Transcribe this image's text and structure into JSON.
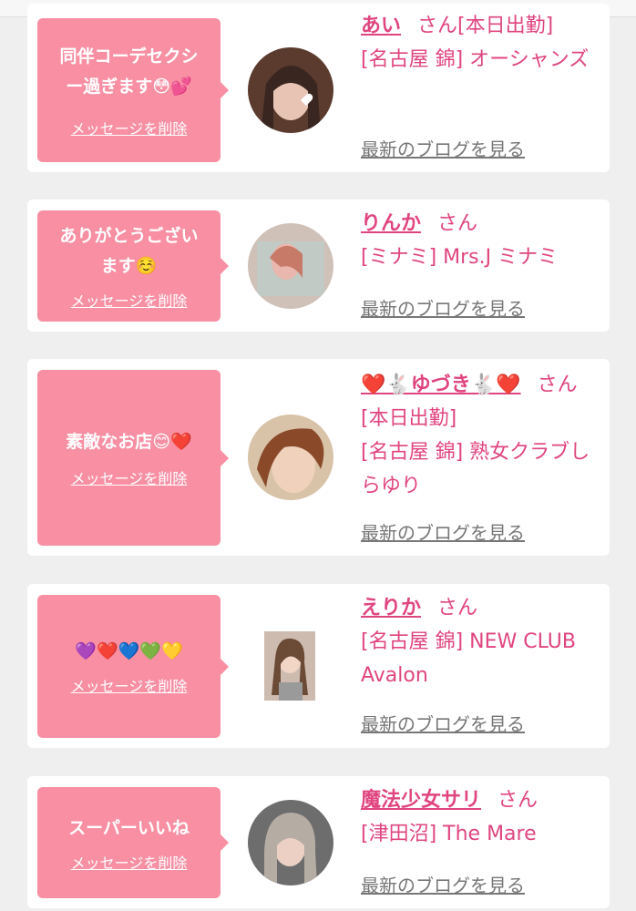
{
  "delete_label": "メッセージを削除",
  "blog_label": "最新のブログを見る",
  "honorific": "さん",
  "cards": [
    {
      "message_line1": "同伴コーデセクシ",
      "message_line2": "ー過ぎます😳💕",
      "name": "あい",
      "status": "[本日出勤]",
      "shop": "[名古屋 錦] オーシャンズ",
      "avatar_icon": "portrait-photo"
    },
    {
      "message_line1": "ありがとうござい",
      "message_line2": "ます☺️",
      "name": "りんか",
      "status": "",
      "shop": "[ミナミ] Mrs.J ミナミ",
      "avatar_icon": "portrait-photo"
    },
    {
      "message_line1": "素敵なお店😊❤️",
      "message_line2": "",
      "name": "❤️🐇ゆづき🐇❤️",
      "status": "[本日出勤]",
      "shop": "[名古屋 錦] 熟女クラブしらゆり",
      "avatar_icon": "portrait-photo"
    },
    {
      "message_line1": "💜❤️💙💚💛",
      "message_line2": "",
      "name": "えりか",
      "status": "",
      "shop": "[名古屋 錦] NEW CLUB Avalon",
      "avatar_icon": "portrait-photo"
    },
    {
      "message_line1": "スーパーいいね",
      "message_line2": "",
      "name": "魔法少女サリ",
      "status": "",
      "shop": "[津田沼] The Mare",
      "avatar_icon": "portrait-photo"
    }
  ],
  "colors": {
    "accent": "#e0457f",
    "bubble": "#f88fa3",
    "background": "#efefef"
  }
}
